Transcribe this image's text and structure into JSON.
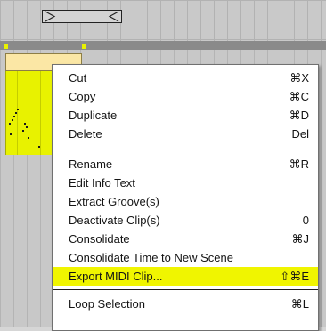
{
  "menu": {
    "items": [
      {
        "label": "Cut",
        "shortcut": "⌘X"
      },
      {
        "label": "Copy",
        "shortcut": "⌘C"
      },
      {
        "label": "Duplicate",
        "shortcut": "⌘D"
      },
      {
        "label": "Delete",
        "shortcut": "Del"
      },
      {
        "label": "Rename",
        "shortcut": "⌘R"
      },
      {
        "label": "Edit Info Text",
        "shortcut": ""
      },
      {
        "label": "Extract Groove(s)",
        "shortcut": ""
      },
      {
        "label": "Deactivate Clip(s)",
        "shortcut": "0"
      },
      {
        "label": "Consolidate",
        "shortcut": "⌘J"
      },
      {
        "label": "Consolidate Time to New Scene",
        "shortcut": ""
      },
      {
        "label": "Export MIDI Clip...",
        "shortcut": "⇧⌘E"
      },
      {
        "label": "Loop Selection",
        "shortcut": "⌘L"
      }
    ],
    "highlighted_item": "Export MIDI Clip..."
  },
  "colors": {
    "highlight": "#f0f500",
    "clip": "#e8f200",
    "clip_header": "#fbe7a5"
  }
}
